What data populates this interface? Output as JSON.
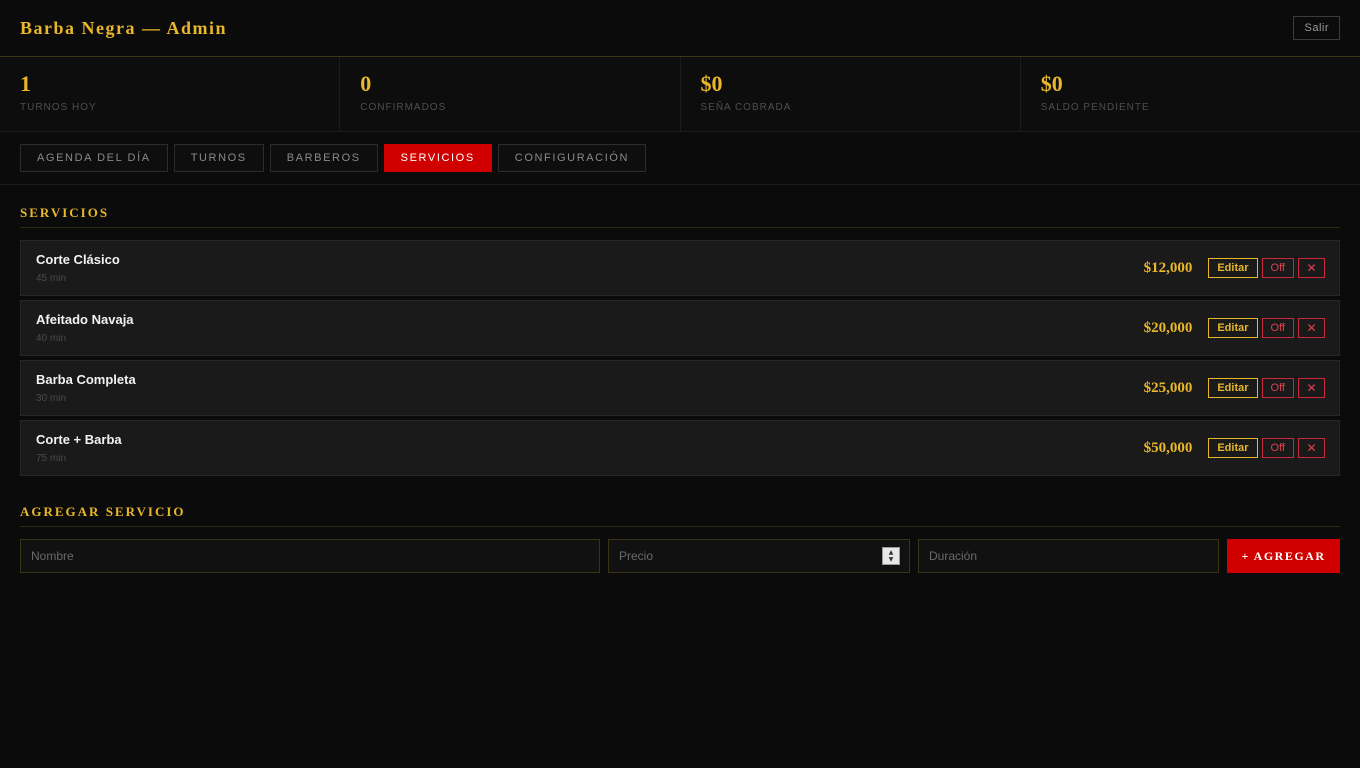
{
  "header": {
    "title": "Barba Negra — Admin",
    "logout_label": "Salir"
  },
  "stats": [
    {
      "value": "1",
      "label": "TURNOS HOY"
    },
    {
      "value": "0",
      "label": "CONFIRMADOS"
    },
    {
      "value": "$0",
      "label": "SEÑA COBRADA"
    },
    {
      "value": "$0",
      "label": "SALDO PENDIENTE"
    }
  ],
  "tabs": [
    {
      "label": "AGENDA DEL DÍA",
      "active": false
    },
    {
      "label": "TURNOS",
      "active": false
    },
    {
      "label": "BARBEROS",
      "active": false
    },
    {
      "label": "SERVICIOS",
      "active": true
    },
    {
      "label": "CONFIGURACIÓN",
      "active": false
    }
  ],
  "services_section": {
    "title": "SERVICIOS",
    "edit_label": "Editar",
    "off_label": "Off",
    "delete_label": "✕",
    "items": [
      {
        "name": "Corte Clásico",
        "duration": "45 min",
        "price": "$12,000"
      },
      {
        "name": "Afeitado Navaja",
        "duration": "40 min",
        "price": "$20,000"
      },
      {
        "name": "Barba Completa",
        "duration": "30 min",
        "price": "$25,000"
      },
      {
        "name": "Corte + Barba",
        "duration": "75 min",
        "price": "$50,000"
      }
    ]
  },
  "add_section": {
    "title": "AGREGAR SERVICIO",
    "name_placeholder": "Nombre",
    "name_value": "",
    "price_placeholder": "Precio",
    "price_value": "",
    "duration_placeholder": "Duración",
    "duration_value": "",
    "add_label": "+ AGREGAR"
  },
  "colors": {
    "accent_gold": "#e9b72a",
    "accent_red": "#d10000",
    "background": "#0b0b0b"
  }
}
